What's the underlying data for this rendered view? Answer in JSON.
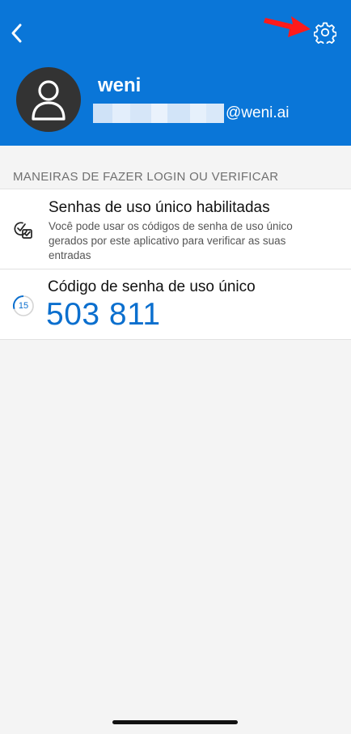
{
  "header": {
    "back_icon": "chevron-left-icon",
    "settings_icon": "gear-icon",
    "annotation": "red-arrow-pointing-to-settings",
    "color": "#0a76d8"
  },
  "account": {
    "name": "weni",
    "email_domain": "@weni.ai",
    "avatar_icon": "person-icon"
  },
  "section": {
    "title": "MANEIRAS DE FAZER LOGIN OU VERIFICAR"
  },
  "otp_enabled": {
    "title": "Senhas de uso único habilitadas",
    "description": "Você pode usar os códigos de senha de uso único gerados por este aplicativo para verificar as suas entradas",
    "icon": "checkbox-verify-icon"
  },
  "otp_code": {
    "title": "Código de senha de uso único",
    "code": "503 811",
    "timer": "15",
    "accent": "#0b6fce"
  }
}
